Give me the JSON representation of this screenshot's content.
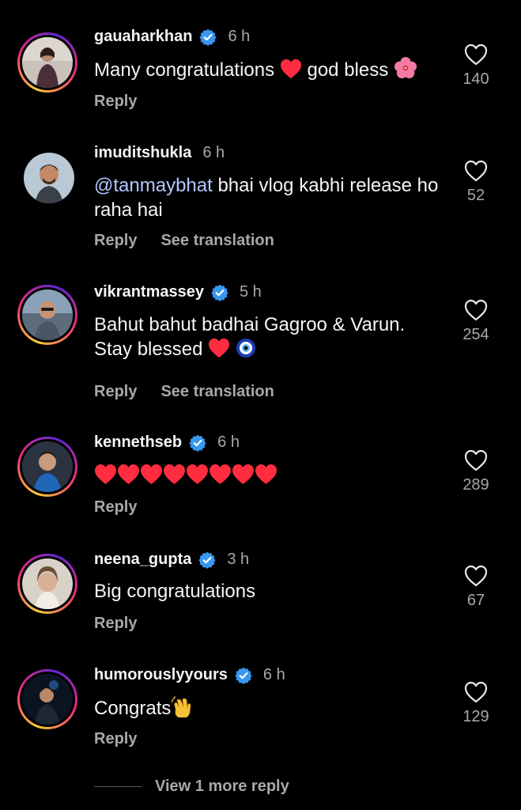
{
  "comments": [
    {
      "username": "gauaharkhan",
      "verified": true,
      "time": "6 h",
      "text": "Many congratulations",
      "text_after": "god bless",
      "likes": "140",
      "reply": "Reply"
    },
    {
      "username": "imuditshukla",
      "verified": false,
      "time": "6 h",
      "mention": "@tanmaybhat",
      "text": " bhai vlog kabhi release ho raha hai",
      "likes": "52",
      "reply": "Reply",
      "translate": "See translation"
    },
    {
      "username": "vikrantmassey",
      "verified": true,
      "time": "5 h",
      "text": "Bahut bahut badhai Gagroo & Varun. Stay blessed",
      "likes": "254",
      "reply": "Reply",
      "translate": "See translation"
    },
    {
      "username": "kennethseb",
      "verified": true,
      "time": "6 h",
      "likes": "289",
      "reply": "Reply"
    },
    {
      "username": "neena_gupta",
      "verified": true,
      "time": "3 h",
      "text": "Big congratulations",
      "likes": "67",
      "reply": "Reply"
    },
    {
      "username": "humorouslyyours",
      "verified": true,
      "time": "6 h",
      "text": "Congrats",
      "likes": "129",
      "reply": "Reply"
    }
  ],
  "view_more": "View 1 more reply",
  "colors": {
    "background": "#000000",
    "mention": "#b3c6ff",
    "verified": "#3897f0",
    "secondary": "#a8a8a8"
  }
}
